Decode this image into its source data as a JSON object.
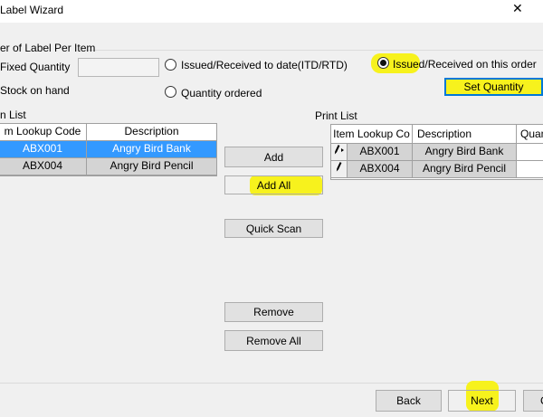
{
  "window": {
    "title": "Label Wizard",
    "close_glyph": "✕"
  },
  "options": {
    "group_title": "er of Label Per Item",
    "fixed_quantity_label": "Fixed Quantity",
    "stock_on_hand_label": "Stock  on hand",
    "fixed_quantity_value": "",
    "radio_itd_label": "Issued/Received to date(ITD/RTD)",
    "radio_qty_ordered_label": "Quantity ordered",
    "radio_this_order_label_highlight": "Issued",
    "radio_this_order_label_rest": "/Received on this order",
    "selected_radio": "issued-received-on-this-order",
    "set_quantity_label": "Set Quantity"
  },
  "item_list": {
    "title": "n List",
    "columns": [
      "m Lookup Code",
      "Description"
    ],
    "rows": [
      {
        "code": "ABX001",
        "description": "Angry Bird Bank",
        "selected": true
      },
      {
        "code": "ABX004",
        "description": "Angry Bird Pencil",
        "selected": false
      }
    ]
  },
  "actions": {
    "add": "Add",
    "add_all": "Add All",
    "quick_scan": "Quick Scan",
    "remove": "Remove",
    "remove_all": "Remove All"
  },
  "print_list": {
    "title": "Print List",
    "columns": [
      "Item Lookup Co",
      "Description",
      "Quan"
    ],
    "rows": [
      {
        "code": "ABX001",
        "description": "Angry Bird Bank",
        "quantity": ""
      },
      {
        "code": "ABX004",
        "description": "Angry Bird Pencil",
        "quantity": ""
      }
    ]
  },
  "footer": {
    "back": "Back",
    "next": "Next",
    "cancel_partial": "C"
  },
  "colors": {
    "highlight": "#f7f21d",
    "selection": "#3399ff"
  }
}
